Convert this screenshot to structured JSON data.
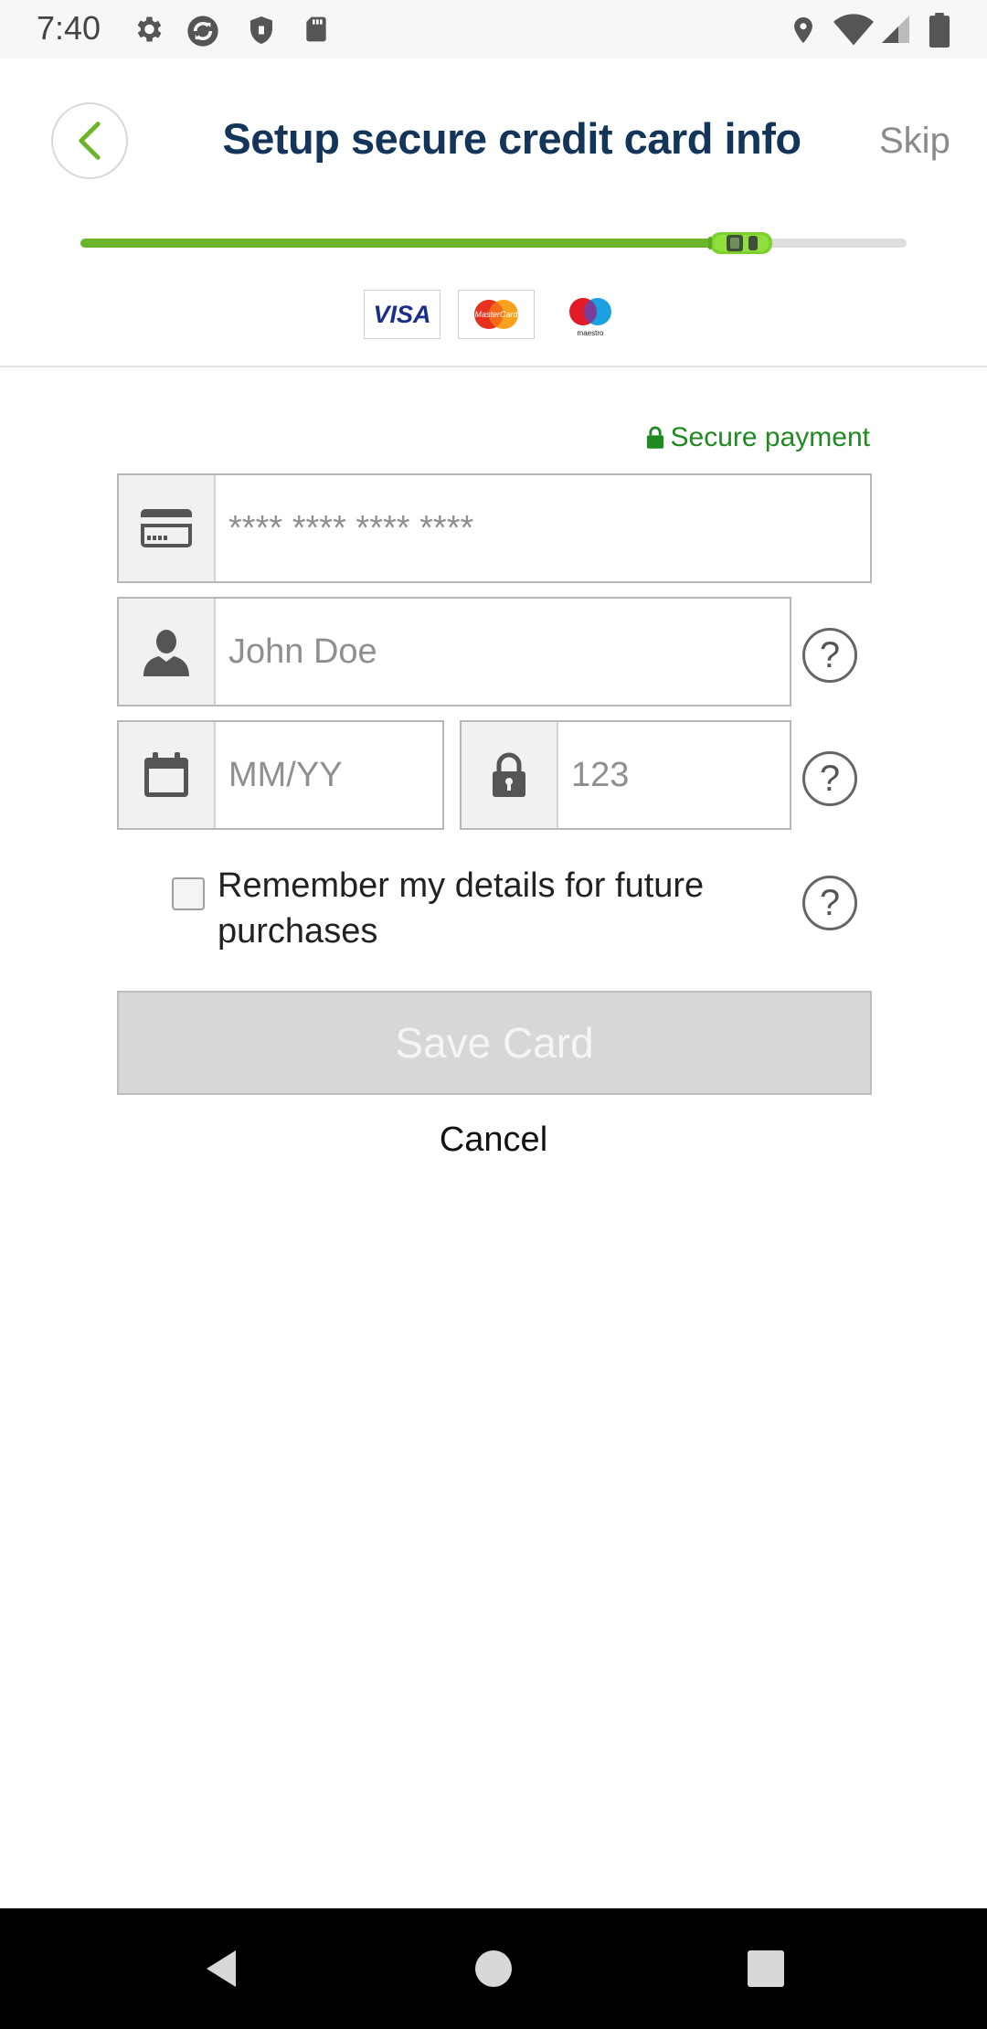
{
  "status_bar": {
    "time": "7:40",
    "left_icons": [
      "gear-icon",
      "sync-icon",
      "shield-icon",
      "sd-card-icon"
    ],
    "right_icons": [
      "location-icon",
      "wifi-icon",
      "signal-icon",
      "battery-icon"
    ]
  },
  "header": {
    "back_icon": "chevron-left-icon",
    "title": "Setup secure credit card info",
    "skip_label": "Skip"
  },
  "progress": {
    "fraction": 0.8,
    "fill_color": "#6cb52b",
    "marker_icon": "car-icon"
  },
  "card_logos": [
    {
      "name": "VISA",
      "icon": "visa-logo"
    },
    {
      "name": "MasterCard",
      "icon": "mastercard-logo"
    },
    {
      "name": "maestro",
      "icon": "maestro-logo"
    }
  ],
  "form": {
    "secure_payment": "Secure payment",
    "card_number": {
      "icon": "credit-card-icon",
      "placeholder": "**** **** **** ****",
      "value": ""
    },
    "name": {
      "icon": "person-icon",
      "placeholder": "John Doe",
      "value": ""
    },
    "expiry": {
      "icon": "calendar-icon",
      "placeholder": "MM/YY",
      "value": ""
    },
    "cvv": {
      "icon": "lock-icon",
      "placeholder": "123",
      "value": ""
    },
    "help_symbol": "?",
    "remember_label": "Remember my details for future purchases",
    "remember_checked": false,
    "save_label": "Save Card",
    "cancel_label": "Cancel"
  },
  "nav_bar": {
    "buttons": [
      "back-triangle-icon",
      "home-circle-icon",
      "recents-square-icon"
    ]
  },
  "colors": {
    "title": "#14355a",
    "accent_green": "#6cb52b",
    "secure_green": "#1f8a1f",
    "button_disabled": "#d7d7d7"
  }
}
